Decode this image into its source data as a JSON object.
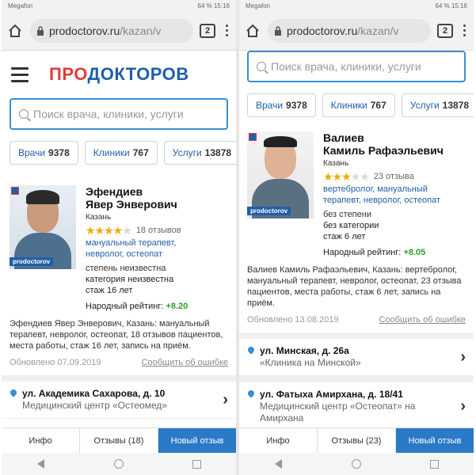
{
  "left": {
    "status": {
      "carrier": "Megafon",
      "right": "64 % 15:16"
    },
    "browser": {
      "domain": "prodoctorov.ru",
      "path": "/kazan/v",
      "tabs": "2"
    },
    "logo": {
      "pro": "ПРО",
      "doc": "ДОКТОРОВ"
    },
    "search": {
      "placeholder": "Поиск врача, клиники, услуги"
    },
    "chips": [
      {
        "label": "Врачи",
        "count": "9378"
      },
      {
        "label": "Клиники",
        "count": "767"
      },
      {
        "label": "Услуги",
        "count": "13878"
      }
    ],
    "doctor": {
      "photo_tag": "prodoctorov",
      "last_name": "Эфендиев",
      "first_name": "Явер Энверович",
      "city": "Казань",
      "stars": 4,
      "reviews": "18 отзывов",
      "spec1": "мануальный терапевт,",
      "spec2": "невролог, остеопат",
      "degree": "степень неизвестна",
      "category": "категория неизвестна",
      "experience": "стаж 16 лет",
      "rating_label": "Народный рейтинг:",
      "rating_value": "+8.20"
    },
    "description": "Эфендиев Явер Энверович, Казань: мануальный терапевт, невролог, остеопат, 18 отзывов пациентов, места работы, стаж 16 лет, запись на приём.",
    "updated": "Обновлено 07.09.2019",
    "report": "Сообщить об ошибке",
    "address": {
      "street": "ул. Академика Сахарова, д. 10",
      "clinic": "Медицинский центр «Остеомед»"
    },
    "tabs": {
      "info": "Инфо",
      "reviews": "Отзывы (18)",
      "new": "Новый отзыв"
    }
  },
  "right": {
    "status": {
      "carrier": "Megafon",
      "right": "64 % 15:16"
    },
    "browser": {
      "domain": "prodoctorov.ru",
      "path": "/kazan/v",
      "tabs": "2"
    },
    "search": {
      "placeholder": "Поиск врача, клиники, услуги"
    },
    "chips": [
      {
        "label": "Врачи",
        "count": "9378"
      },
      {
        "label": "Клиники",
        "count": "767"
      },
      {
        "label": "Услуги",
        "count": "13878"
      }
    ],
    "doctor": {
      "photo_tag": "prodoctorov",
      "last_name": "Валиев",
      "first_name": "Камиль Рафаэльевич",
      "city": "Казань",
      "stars": 3,
      "reviews": "23 отзыва",
      "spec1": "вертебролог, мануальный",
      "spec2": "терапевт, невролог, остеопат",
      "degree": "без степени",
      "category": "без категории",
      "experience": "стаж 6 лет",
      "rating_label": "Народный рейтинг:",
      "rating_value": "+8.05"
    },
    "description": "Валиев Камиль Рафаэльевич, Казань: вертебролог, мануальный терапевт, невролог, остеопат, 23 отзыва пациентов, места работы, стаж 6 лет, запись на приём.",
    "updated": "Обновлено 13.08.2019",
    "report": "Сообщить об ошибке",
    "address1": {
      "street": "ул. Минская, д. 26а",
      "clinic": "«Клиника на Минской»"
    },
    "address2": {
      "street": "ул. Фатыха Амирхана, д. 18/41",
      "clinic": "Медицинский центр «Остеопат» на Амирхана"
    },
    "tabs": {
      "info": "Инфо",
      "reviews": "Отзывы (23)",
      "new": "Новый отзыв"
    }
  },
  "colors": {
    "accent": "#2a7ac7",
    "brand_red": "#e03c3c",
    "rating_green": "#2a9d2a",
    "star": "#f2a900"
  }
}
